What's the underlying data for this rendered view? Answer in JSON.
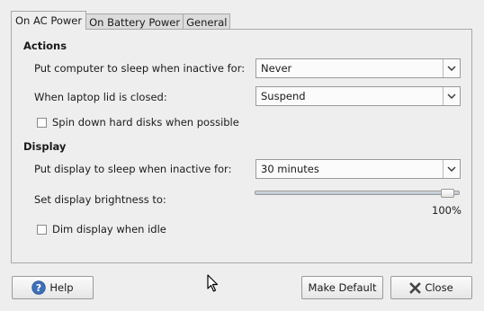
{
  "tabs": [
    {
      "label": "On AC Power",
      "active": true
    },
    {
      "label": "On Battery Power",
      "active": false
    },
    {
      "label": "General",
      "active": false
    }
  ],
  "actions": {
    "title": "Actions",
    "sleep_label": "Put computer to sleep when inactive for:",
    "sleep_value": "Never",
    "lid_label": "When laptop lid is closed:",
    "lid_value": "Suspend",
    "spin_label": "Spin down hard disks when possible",
    "spin_checked": false
  },
  "display": {
    "title": "Display",
    "sleep_label": "Put display to sleep when inactive for:",
    "sleep_value": "30 minutes",
    "brightness_label": "Set display brightness to:",
    "brightness_fraction": 1.0,
    "brightness_text": "100%",
    "dim_label": "Dim display when idle",
    "dim_checked": false
  },
  "buttons": {
    "help": "Help",
    "make_default": "Make Default",
    "close": "Close"
  },
  "icons": {
    "dropdown": "chevron-down-icon",
    "help": "help-icon",
    "close": "close-x-icon",
    "cursor": "mouse-pointer-icon"
  },
  "colors": {
    "help_icon": "#3d6fb8",
    "close_icon": "#444444"
  }
}
